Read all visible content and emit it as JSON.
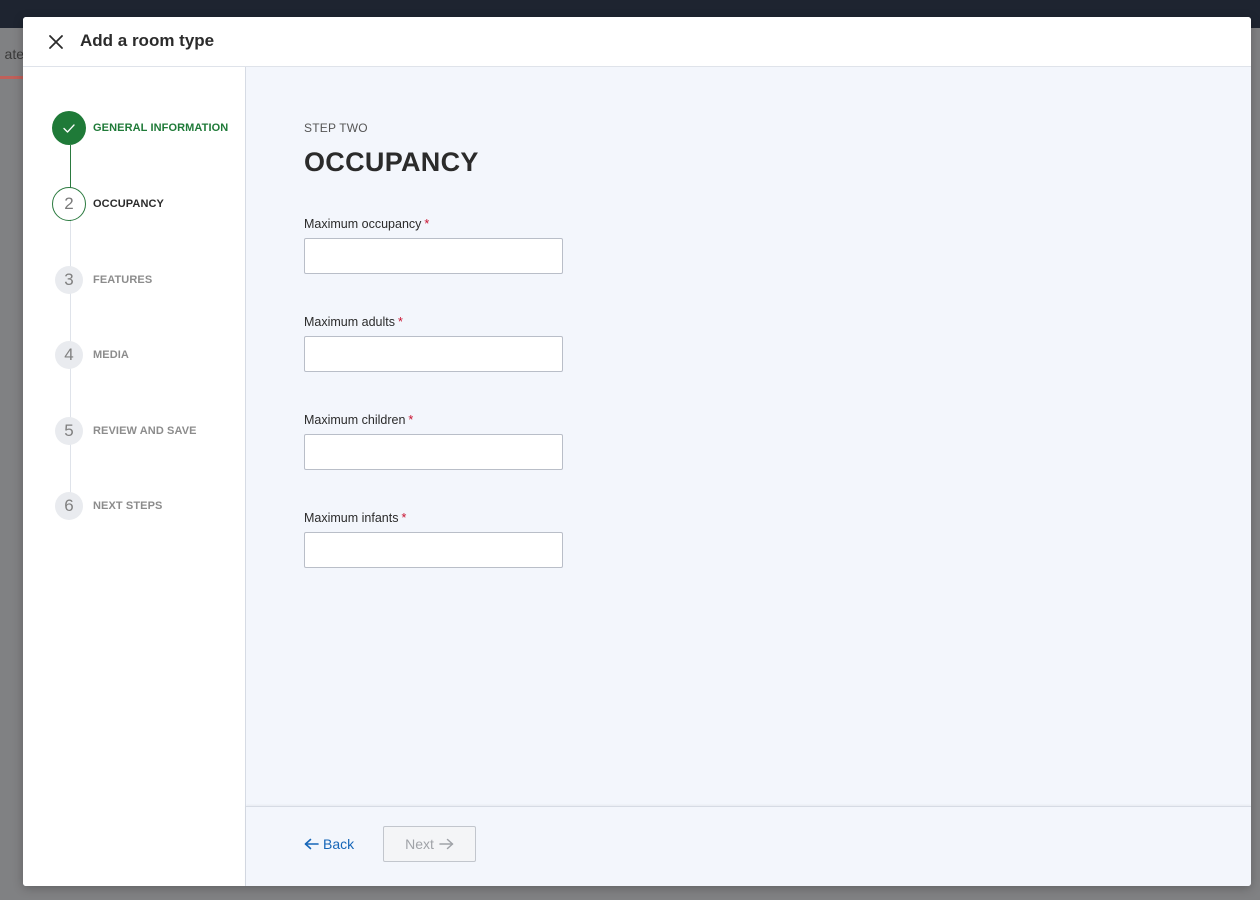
{
  "background": {
    "tab_text": "ate"
  },
  "modal": {
    "title": "Add a room type",
    "close_icon": "close-icon"
  },
  "stepper": {
    "steps": [
      {
        "number": "1",
        "label": "GENERAL INFORMATION",
        "state": "completed",
        "icon": "check-icon"
      },
      {
        "number": "2",
        "label": "OCCUPANCY",
        "state": "active"
      },
      {
        "number": "3",
        "label": "FEATURES",
        "state": "pending"
      },
      {
        "number": "4",
        "label": "MEDIA",
        "state": "pending"
      },
      {
        "number": "5",
        "label": "REVIEW AND SAVE",
        "state": "pending"
      },
      {
        "number": "6",
        "label": "NEXT STEPS",
        "state": "pending"
      }
    ]
  },
  "form": {
    "kicker": "STEP TWO",
    "title": "OCCUPANCY",
    "required_marker": "*",
    "fields": [
      {
        "label": "Maximum occupancy",
        "value": "",
        "placeholder": ""
      },
      {
        "label": "Maximum adults",
        "value": "",
        "placeholder": ""
      },
      {
        "label": "Maximum children",
        "value": "",
        "placeholder": ""
      },
      {
        "label": "Maximum infants",
        "value": "",
        "placeholder": ""
      }
    ]
  },
  "footer": {
    "back_label": "Back",
    "next_label": "Next",
    "next_disabled": true
  },
  "colors": {
    "accent_green": "#1f7a38",
    "link_blue": "#1666b8",
    "required_red": "#c8102e"
  }
}
